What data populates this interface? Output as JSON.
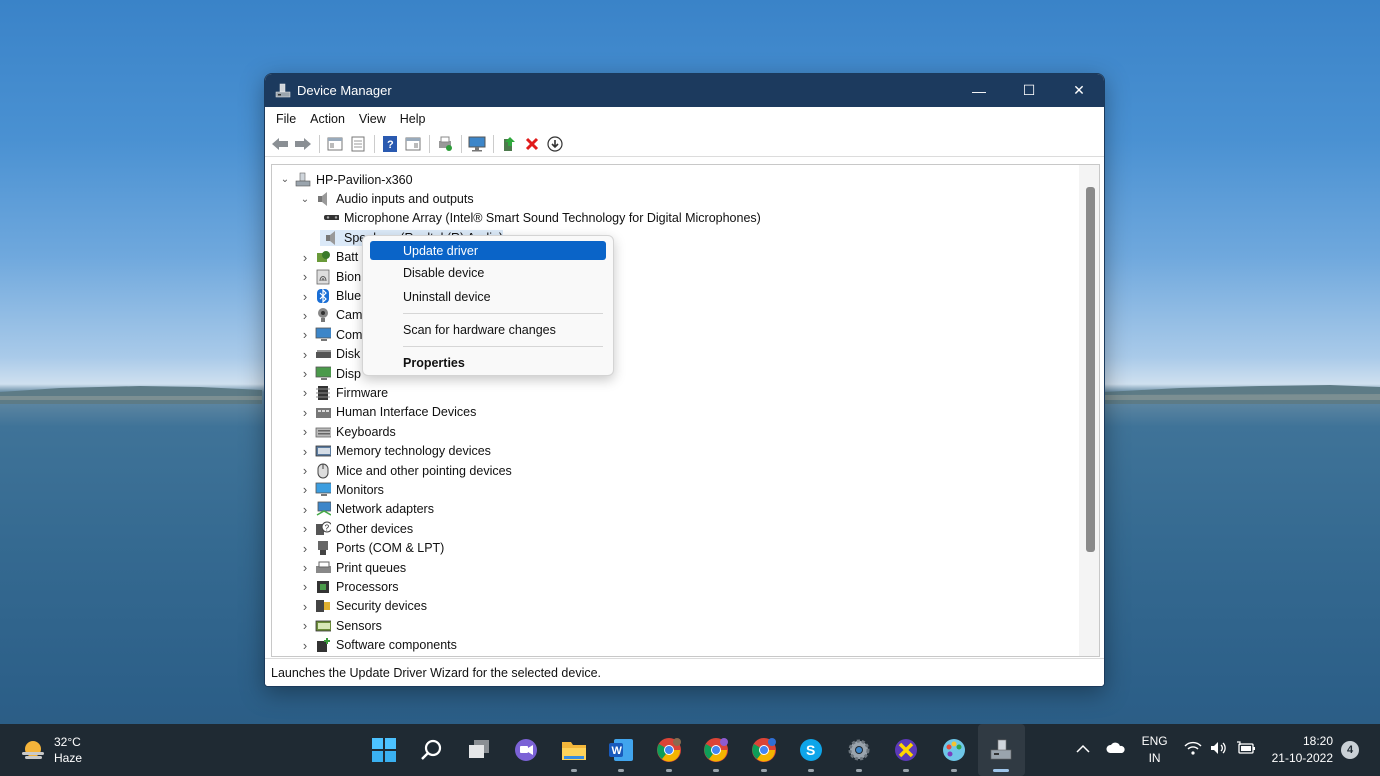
{
  "window": {
    "title": "Device Manager",
    "controls": {
      "minimize": "—",
      "maximize": "☐",
      "close": "✕"
    }
  },
  "menubar": [
    "File",
    "Action",
    "View",
    "Help"
  ],
  "tree": {
    "root": "HP-Pavilion-x360",
    "audio_category": "Audio inputs and outputs",
    "audio_children": [
      "Microphone Array (Intel® Smart Sound Technology for Digital Microphones)",
      "Speakers (Realtek(R) Audio)"
    ],
    "categories": [
      {
        "label": "Batt",
        "icon": "battery-icon"
      },
      {
        "label": "Bion",
        "icon": "fingerprint-icon"
      },
      {
        "label": "Blue",
        "icon": "bluetooth-icon"
      },
      {
        "label": "Cam",
        "icon": "camera-icon"
      },
      {
        "label": "Com",
        "icon": "computer-icon"
      },
      {
        "label": "Disk",
        "icon": "disk-icon"
      },
      {
        "label": "Disp",
        "icon": "display-adapter-icon"
      },
      {
        "label": "Firmware",
        "icon": "firmware-icon"
      },
      {
        "label": "Human Interface Devices",
        "icon": "hid-icon"
      },
      {
        "label": "Keyboards",
        "icon": "keyboard-icon"
      },
      {
        "label": "Memory technology devices",
        "icon": "memory-icon"
      },
      {
        "label": "Mice and other pointing devices",
        "icon": "mouse-icon"
      },
      {
        "label": "Monitors",
        "icon": "monitor-icon"
      },
      {
        "label": "Network adapters",
        "icon": "network-icon"
      },
      {
        "label": "Other devices",
        "icon": "unknown-device-icon"
      },
      {
        "label": "Ports (COM & LPT)",
        "icon": "port-icon"
      },
      {
        "label": "Print queues",
        "icon": "printer-icon"
      },
      {
        "label": "Processors",
        "icon": "processor-icon"
      },
      {
        "label": "Security devices",
        "icon": "security-icon"
      },
      {
        "label": "Sensors",
        "icon": "sensor-icon"
      },
      {
        "label": "Software components",
        "icon": "software-components-icon"
      }
    ]
  },
  "context_menu": {
    "update": "Update driver",
    "disable": "Disable device",
    "uninstall": "Uninstall device",
    "scan": "Scan for hardware changes",
    "properties": "Properties"
  },
  "status": "Launches the Update Driver Wizard for the selected device.",
  "taskbar": {
    "weather_temp": "32°C",
    "weather_desc": "Haze",
    "lang": "ENG",
    "region": "IN",
    "time": "18:20",
    "date": "21-10-2022",
    "notifications": "4"
  },
  "colors": {
    "accent": "#0a64c8",
    "titlebar": "#1c3a5e",
    "taskbar": "#1f2a33"
  }
}
